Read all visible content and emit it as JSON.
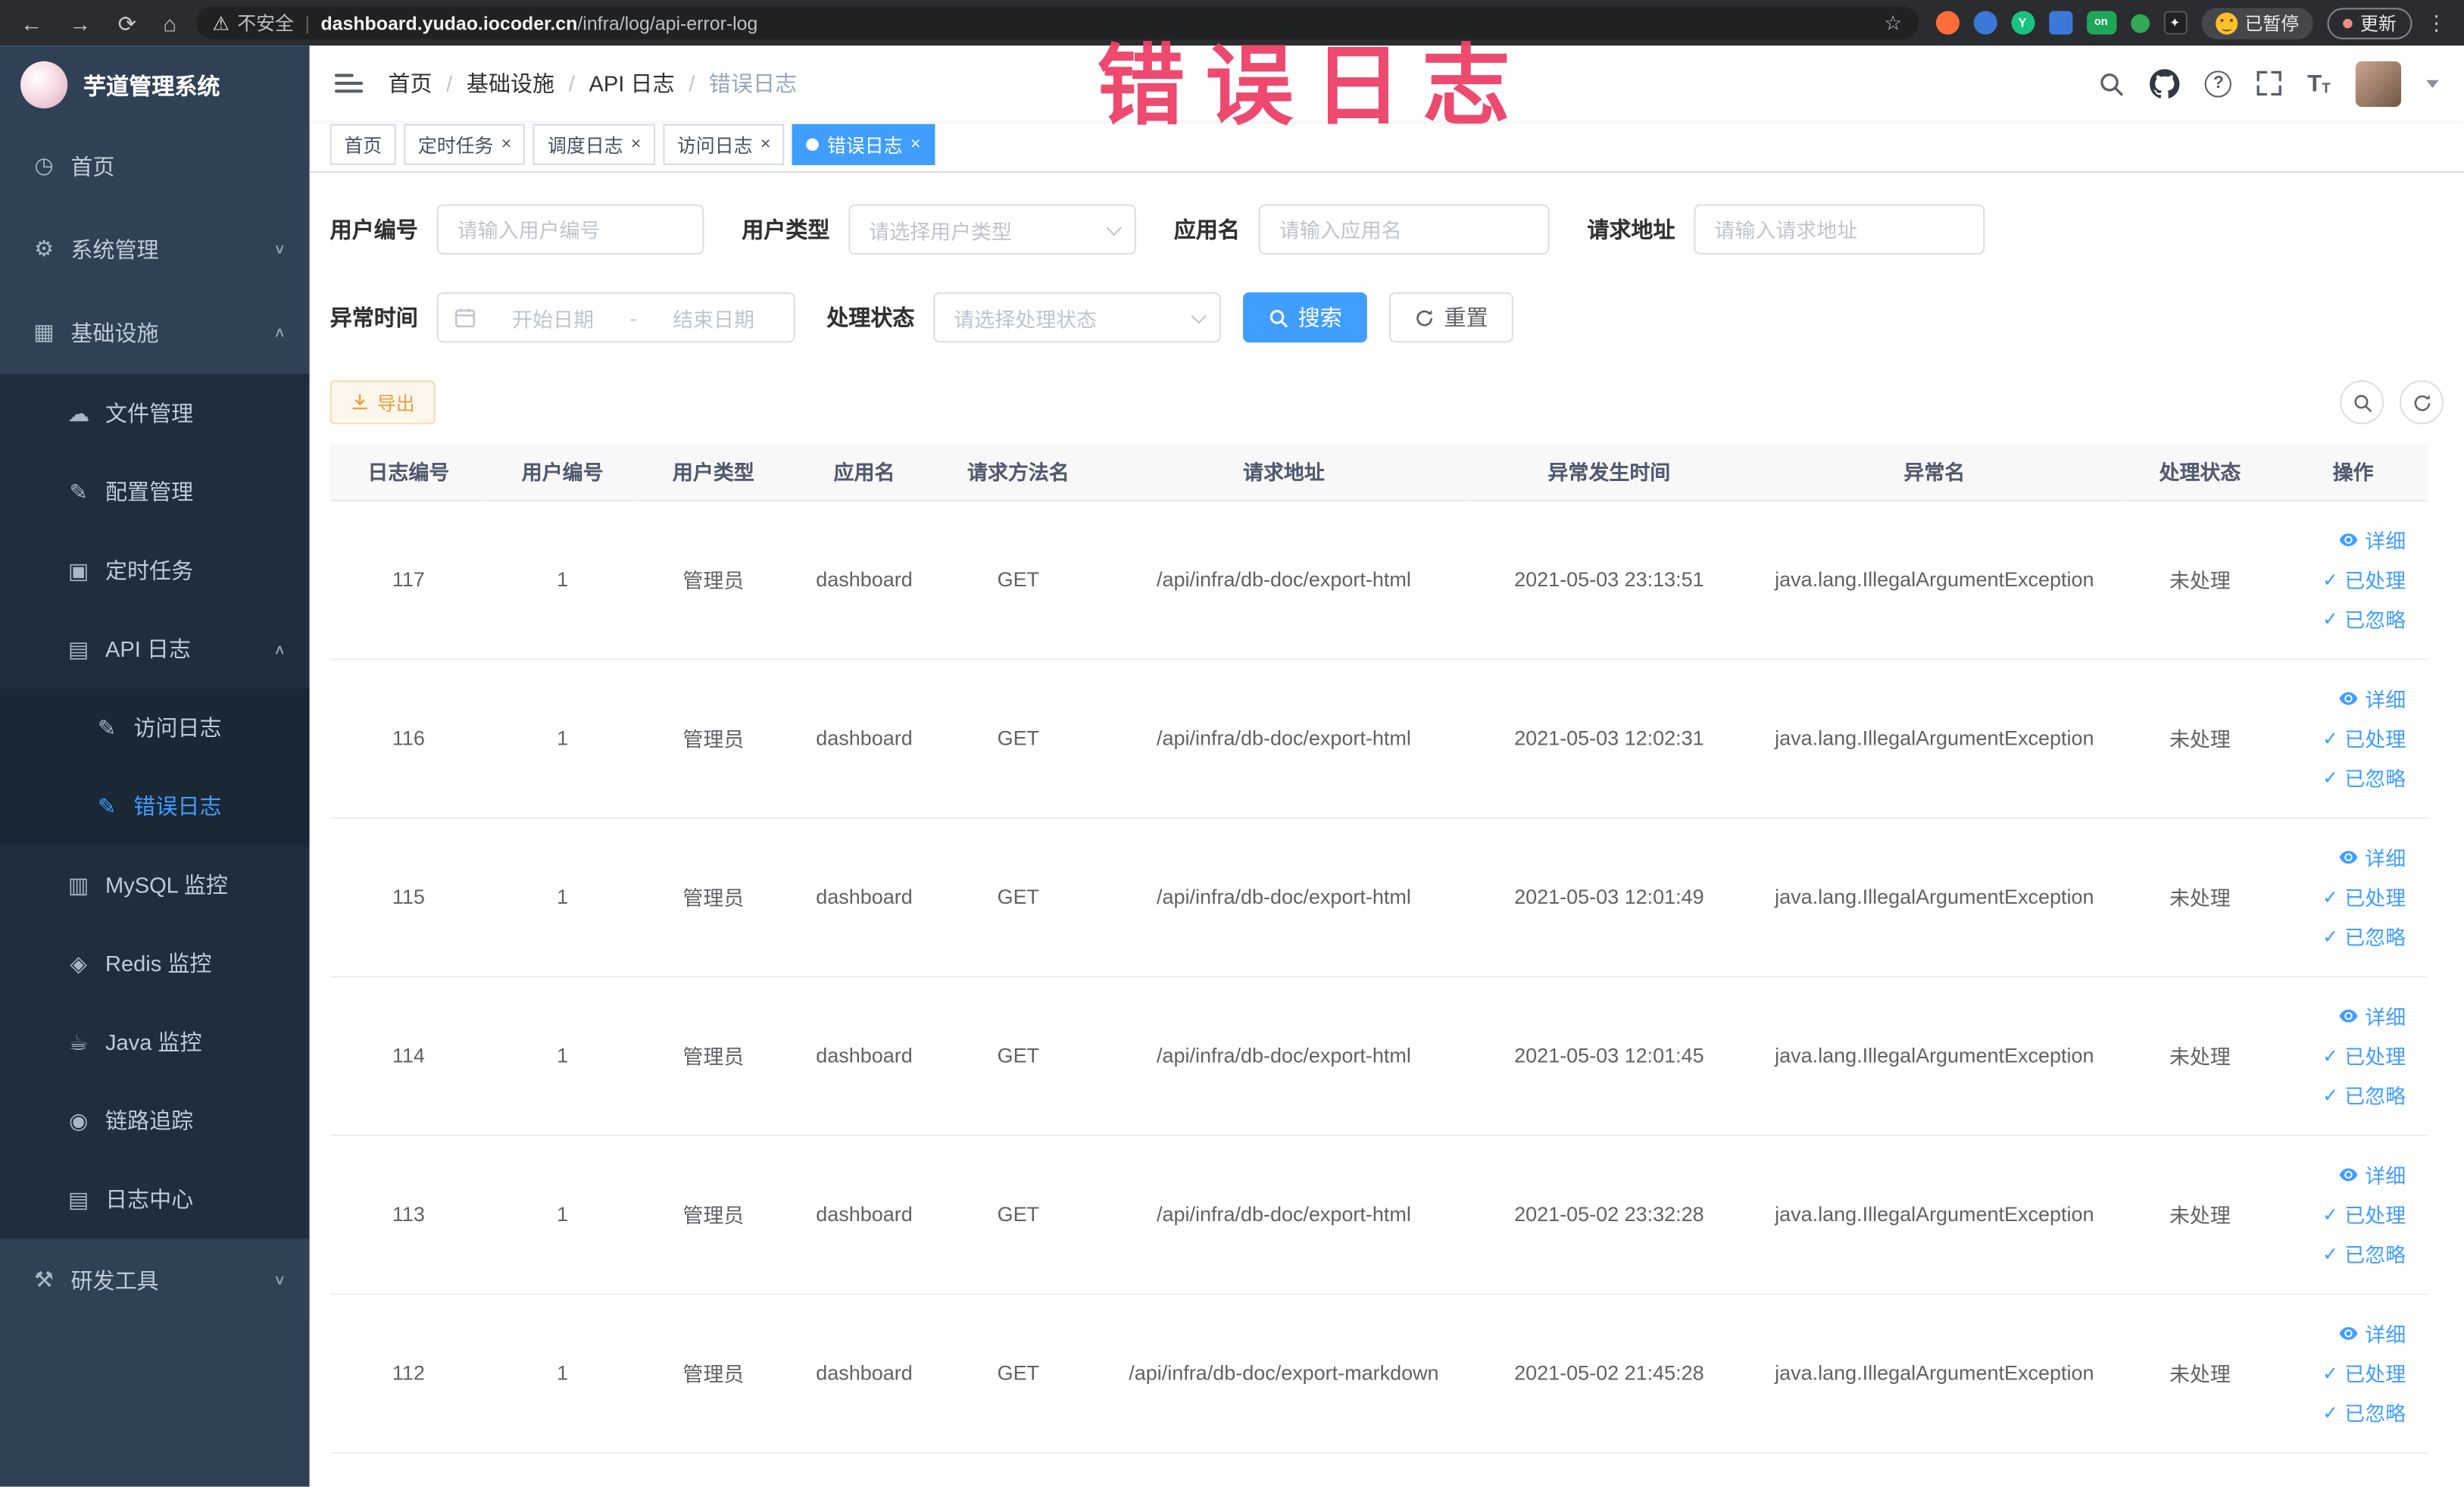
{
  "browser": {
    "security_label": "不安全",
    "url_host": "dashboard.yudao.iocoder.cn",
    "url_path": "/infra/log/api-error-log",
    "ext5_label": "on",
    "profile_chip": "已暂停",
    "update_button": "更新"
  },
  "annotation": {
    "watermark": "错误日志",
    "color": "#ee4068"
  },
  "icons": {
    "back": "←",
    "forward": "→",
    "reload": "⟳",
    "home": "⌂",
    "warning": "⚠",
    "star": "☆",
    "kebab": "⋮",
    "dashboard": "◷",
    "gear": "⚙",
    "infra": "▦",
    "file": "☁",
    "config": "✎",
    "job": "▣",
    "api-log": "▤",
    "doc-edit": "✎",
    "mysql": "▥",
    "redis": "◈",
    "java": "☕",
    "trace": "◉",
    "log-center": "▤",
    "tools": "⚒",
    "chevron-down": "∨",
    "chevron-up": "∧",
    "question": "?",
    "check": "✓"
  },
  "sidebar": {
    "title": "芋道管理系统",
    "items": [
      {
        "label": "首页"
      },
      {
        "label": "系统管理"
      },
      {
        "label": "基础设施"
      },
      {
        "label": "文件管理"
      },
      {
        "label": "配置管理"
      },
      {
        "label": "定时任务"
      },
      {
        "label": "API 日志"
      },
      {
        "label": "访问日志"
      },
      {
        "label": "错误日志"
      },
      {
        "label": "MySQL 监控"
      },
      {
        "label": "Redis 监控"
      },
      {
        "label": "Java 监控"
      },
      {
        "label": "链路追踪"
      },
      {
        "label": "日志中心"
      },
      {
        "label": "研发工具"
      }
    ]
  },
  "header": {
    "breadcrumb": [
      "首页",
      "基础设施",
      "API 日志",
      "错误日志"
    ]
  },
  "tabs": [
    {
      "label": "首页"
    },
    {
      "label": "定时任务"
    },
    {
      "label": "调度日志"
    },
    {
      "label": "访问日志"
    },
    {
      "label": "错误日志"
    }
  ],
  "filters": {
    "user_id_label": "用户编号",
    "user_id_placeholder": "请输入用户编号",
    "user_type_label": "用户类型",
    "user_type_placeholder": "请选择用户类型",
    "app_name_label": "应用名",
    "app_name_placeholder": "请输入应用名",
    "request_url_label": "请求地址",
    "request_url_placeholder": "请输入请求地址",
    "exception_time_label": "异常时间",
    "start_date_placeholder": "开始日期",
    "range_separator": "-",
    "end_date_placeholder": "结束日期",
    "status_label": "处理状态",
    "status_placeholder": "请选择处理状态",
    "search_button": "搜索",
    "reset_button": "重置"
  },
  "toolbar": {
    "export_button": "导出"
  },
  "table": {
    "headers": [
      "日志编号",
      "用户编号",
      "用户类型",
      "应用名",
      "请求方法名",
      "请求地址",
      "异常发生时间",
      "异常名",
      "处理状态",
      "操作"
    ],
    "row_actions": [
      "详细",
      "已处理",
      "已忽略"
    ],
    "rows": [
      {
        "id": "117",
        "user_id": "1",
        "user_type": "管理员",
        "app": "dashboard",
        "method": "GET",
        "url": "/api/infra/db-doc/export-html",
        "time": "2021-05-03 23:13:51",
        "exception": "java.lang.IllegalArgumentException",
        "status": "未处理"
      },
      {
        "id": "116",
        "user_id": "1",
        "user_type": "管理员",
        "app": "dashboard",
        "method": "GET",
        "url": "/api/infra/db-doc/export-html",
        "time": "2021-05-03 12:02:31",
        "exception": "java.lang.IllegalArgumentException",
        "status": "未处理"
      },
      {
        "id": "115",
        "user_id": "1",
        "user_type": "管理员",
        "app": "dashboard",
        "method": "GET",
        "url": "/api/infra/db-doc/export-html",
        "time": "2021-05-03 12:01:49",
        "exception": "java.lang.IllegalArgumentException",
        "status": "未处理"
      },
      {
        "id": "114",
        "user_id": "1",
        "user_type": "管理员",
        "app": "dashboard",
        "method": "GET",
        "url": "/api/infra/db-doc/export-html",
        "time": "2021-05-03 12:01:45",
        "exception": "java.lang.IllegalArgumentException",
        "status": "未处理"
      },
      {
        "id": "113",
        "user_id": "1",
        "user_type": "管理员",
        "app": "dashboard",
        "method": "GET",
        "url": "/api/infra/db-doc/export-html",
        "time": "2021-05-02 23:32:28",
        "exception": "java.lang.IllegalArgumentException",
        "status": "未处理"
      },
      {
        "id": "112",
        "user_id": "1",
        "user_type": "管理员",
        "app": "dashboard",
        "method": "GET",
        "url": "/api/infra/db-doc/export-markdown",
        "time": "2021-05-02 21:45:28",
        "exception": "java.lang.IllegalArgumentException",
        "status": "未处理"
      }
    ]
  },
  "colors": {
    "accent": "#409eff",
    "sidebar_bg": "#304156",
    "submenu_bg": "#1f2d3d",
    "warning": "#e6a23c",
    "watermark": "#ee4068"
  }
}
